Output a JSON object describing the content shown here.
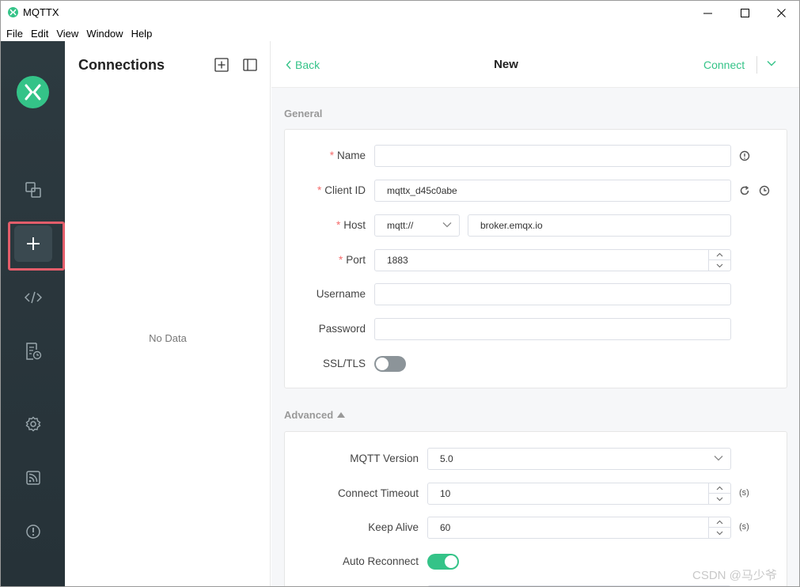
{
  "window": {
    "title": "MQTTX"
  },
  "menu": [
    "File",
    "Edit",
    "View",
    "Window",
    "Help"
  ],
  "nav": {
    "items": [
      "connections-icon",
      "add-icon",
      "script-icon",
      "log-icon",
      "settings-icon",
      "subscribe-icon",
      "about-icon"
    ],
    "active": "add-icon",
    "accent": "#34c388",
    "highlight_color": "#e35d6a"
  },
  "connections": {
    "title": "Connections",
    "empty_text": "No Data"
  },
  "header": {
    "back_label": "Back",
    "title": "New",
    "connect_label": "Connect"
  },
  "general": {
    "section_label": "General",
    "name": {
      "label": "Name",
      "value": ""
    },
    "client_id": {
      "label": "Client ID",
      "value": "mqttx_d45c0abe"
    },
    "host": {
      "label": "Host",
      "protocol": "mqtt://",
      "value": "broker.emqx.io"
    },
    "port": {
      "label": "Port",
      "value": "1883"
    },
    "username": {
      "label": "Username",
      "value": ""
    },
    "password": {
      "label": "Password",
      "value": ""
    },
    "ssl": {
      "label": "SSL/TLS",
      "enabled": false
    }
  },
  "advanced": {
    "section_label": "Advanced",
    "mqtt_version": {
      "label": "MQTT Version",
      "value": "5.0"
    },
    "connect_timeout": {
      "label": "Connect Timeout",
      "value": "10",
      "unit": "(s)"
    },
    "keep_alive": {
      "label": "Keep Alive",
      "value": "60",
      "unit": "(s)"
    },
    "auto_reconnect": {
      "label": "Auto Reconnect",
      "enabled": true
    }
  },
  "watermark": "CSDN @马少爷"
}
